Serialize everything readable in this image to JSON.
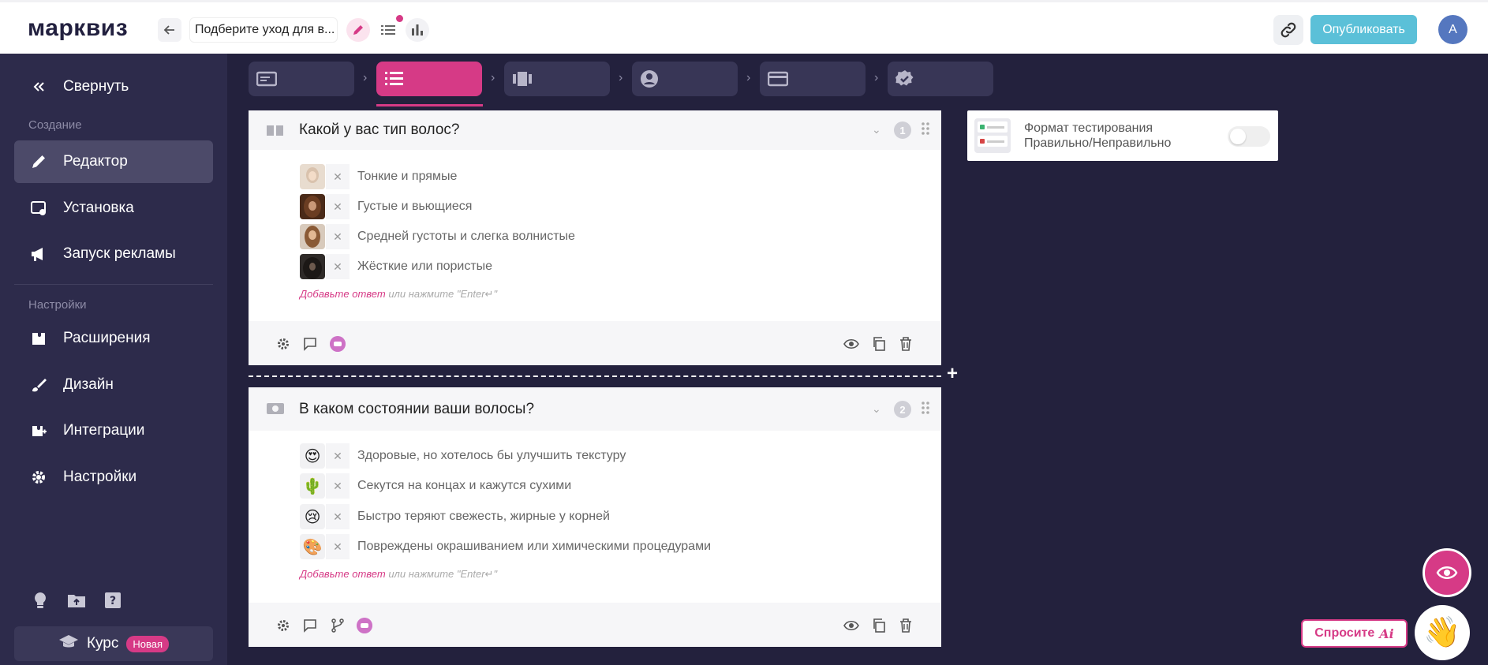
{
  "header": {
    "logo": "марквиз",
    "quiz_title": "Подберите уход для в...",
    "publish_label": "Опубликовать",
    "avatar_initial": "A"
  },
  "sidebar": {
    "collapse_label": "Свернуть",
    "section_create": "Создание",
    "items_create": [
      {
        "label": "Редактор",
        "icon": "pencil-icon",
        "active": true
      },
      {
        "label": "Установка",
        "icon": "install-icon"
      },
      {
        "label": "Запуск рекламы",
        "icon": "megaphone-icon"
      }
    ],
    "section_settings": "Настройки",
    "items_settings": [
      {
        "label": "Расширения",
        "icon": "extension-icon"
      },
      {
        "label": "Дизайн",
        "icon": "brush-icon"
      },
      {
        "label": "Интеграции",
        "icon": "integration-icon"
      },
      {
        "label": "Настройки",
        "icon": "gear-icon"
      }
    ],
    "course_label": "Курс",
    "course_badge": "Новая"
  },
  "steps": [
    {
      "icon": "start-page-icon"
    },
    {
      "icon": "questions-icon",
      "active": true
    },
    {
      "icon": "results-icon"
    },
    {
      "icon": "contacts-icon"
    },
    {
      "icon": "payment-icon"
    },
    {
      "icon": "thank-you-icon"
    }
  ],
  "questions": [
    {
      "number": "1",
      "title": "Какой у вас тип волос?",
      "answers": [
        {
          "text": "Тонкие и прямые",
          "thumb_color": "#d9c2ad"
        },
        {
          "text": "Густые и вьющиеся",
          "thumb_color": "#6b3d22"
        },
        {
          "text": "Средней густоты и слегка волнистые",
          "thumb_color": "#8a5a36"
        },
        {
          "text": "Жёсткие или пористые",
          "thumb_color": "#2e2a28"
        }
      ]
    },
    {
      "number": "2",
      "title": "В каком состоянии ваши волосы?",
      "answers": [
        {
          "text": "Здоровые, но хотелось бы улучшить текстуру",
          "emoji": "😍"
        },
        {
          "text": "Секутся на концах и кажутся сухими",
          "emoji": "🌵"
        },
        {
          "text": "Быстро теряют свежесть, жирные у корней",
          "emoji": "😢"
        },
        {
          "text": "Повреждены окрашиванием или химическими процедурами",
          "emoji": "🎨"
        }
      ]
    }
  ],
  "add_answer": {
    "link": "Добавьте ответ",
    "hint": " или нажмите \"Enter↵\""
  },
  "format_panel": {
    "line1": "Формат тестирования",
    "line2": "Правильно/Неправильно",
    "enabled": false
  },
  "ask": {
    "label": "Спросите",
    "ai": "Ai"
  },
  "wave_emoji": "👋",
  "colors": {
    "accent": "#d63a86",
    "publish": "#5bc0d8",
    "sidebar": "#2d2b4b",
    "canvas": "#23213d"
  }
}
